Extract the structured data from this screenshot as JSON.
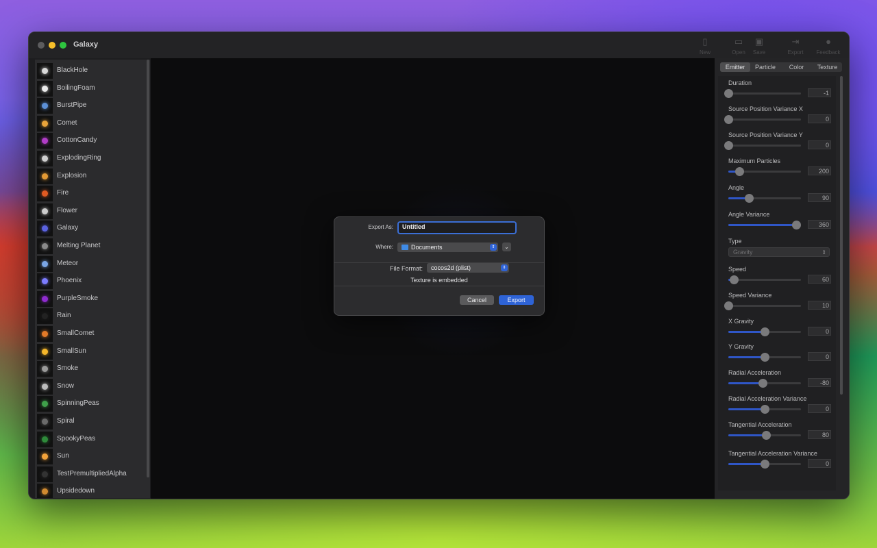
{
  "window": {
    "title": "Galaxy",
    "toolbar": [
      {
        "label": "New",
        "icon": "new-document-icon"
      },
      {
        "label": "Open",
        "icon": "open-folder-icon"
      },
      {
        "label": "Save",
        "icon": "save-disk-icon"
      },
      {
        "label": "Export",
        "icon": "export-icon"
      },
      {
        "label": "Feedback",
        "icon": "feedback-bubble-icon"
      }
    ]
  },
  "sidebar": {
    "items": [
      {
        "label": "BlackHole"
      },
      {
        "label": "BoilingFoam"
      },
      {
        "label": "BurstPipe"
      },
      {
        "label": "Comet"
      },
      {
        "label": "CottonCandy"
      },
      {
        "label": "ExplodingRing"
      },
      {
        "label": "Explosion"
      },
      {
        "label": "Fire"
      },
      {
        "label": "Flower"
      },
      {
        "label": "Galaxy"
      },
      {
        "label": "Melting Planet"
      },
      {
        "label": "Meteor"
      },
      {
        "label": "Phoenix"
      },
      {
        "label": "PurpleSmoke"
      },
      {
        "label": "Rain"
      },
      {
        "label": "SmallComet"
      },
      {
        "label": "SmallSun"
      },
      {
        "label": "Smoke"
      },
      {
        "label": "Snow"
      },
      {
        "label": "SpinningPeas"
      },
      {
        "label": "Spiral"
      },
      {
        "label": "SpookyPeas"
      },
      {
        "label": "Sun"
      },
      {
        "label": "TestPremultipliedAlpha"
      },
      {
        "label": "Upsidedown"
      }
    ]
  },
  "inspector": {
    "tabs": [
      {
        "label": "Emitter",
        "active": true
      },
      {
        "label": "Particle"
      },
      {
        "label": "Color"
      },
      {
        "label": "Texture"
      }
    ],
    "params": [
      {
        "label": "Duration",
        "value": "-1",
        "fraction": 0.0
      },
      {
        "label": "Source Position Variance X",
        "value": "0",
        "fraction": 0.0
      },
      {
        "label": "Source Position Variance Y",
        "value": "0",
        "fraction": 0.0
      },
      {
        "label": "Maximum Particles",
        "value": "200",
        "fraction": 0.15
      },
      {
        "label": "Angle",
        "value": "90",
        "fraction": 0.28
      },
      {
        "label": "Angle Variance",
        "value": "360",
        "fraction": 0.93
      },
      {
        "label": "Type",
        "select": "Gravity"
      },
      {
        "label": "Speed",
        "value": "60",
        "fraction": 0.08
      },
      {
        "label": "Speed Variance",
        "value": "10",
        "fraction": 0.0
      },
      {
        "label": "X Gravity",
        "value": "0",
        "fraction": 0.5
      },
      {
        "label": "Y Gravity",
        "value": "0",
        "fraction": 0.5
      },
      {
        "label": "Radial Acceleration",
        "value": "-80",
        "fraction": 0.47
      },
      {
        "label": "Radial Acceleration Variance",
        "value": "0",
        "fraction": 0.5
      },
      {
        "label": "Tangential Acceleration",
        "value": "80",
        "fraction": 0.52
      },
      {
        "label": "Tangential Acceleration Variance",
        "value": "0",
        "fraction": 0.5
      }
    ]
  },
  "dialog": {
    "export_as_label": "Export As:",
    "filename": "Untitled",
    "where_label": "Where:",
    "where_value": "Documents",
    "format_label": "File Format:",
    "format_value": "cocos2d (plist)",
    "note": "Texture is embedded",
    "cancel_label": "Cancel",
    "export_label": "Export"
  },
  "colors": {
    "accent": "#2e63d6",
    "slider_fill": "#2f56c7",
    "window_bg": "#1d1d1f"
  }
}
